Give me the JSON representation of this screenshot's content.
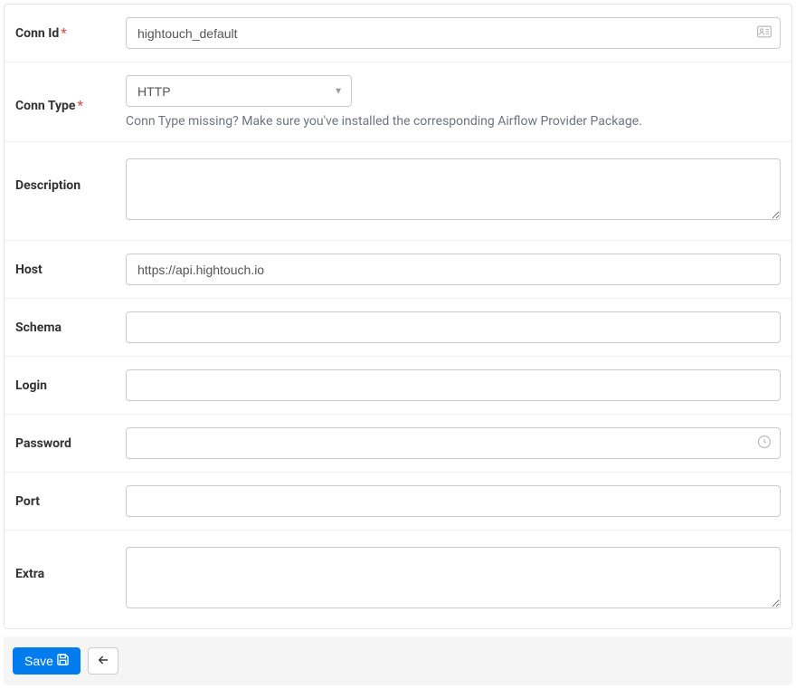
{
  "form": {
    "conn_id": {
      "label": "Conn Id",
      "value": "hightouch_default",
      "required": true
    },
    "conn_type": {
      "label": "Conn Type",
      "value": "HTTP",
      "required": true,
      "help": "Conn Type missing? Make sure you've installed the corresponding Airflow Provider Package."
    },
    "description": {
      "label": "Description",
      "value": ""
    },
    "host": {
      "label": "Host",
      "value": "https://api.hightouch.io"
    },
    "schema": {
      "label": "Schema",
      "value": ""
    },
    "login": {
      "label": "Login",
      "value": ""
    },
    "password": {
      "label": "Password",
      "value": ""
    },
    "port": {
      "label": "Port",
      "value": ""
    },
    "extra": {
      "label": "Extra",
      "value": ""
    }
  },
  "footer": {
    "save_label": "Save"
  }
}
